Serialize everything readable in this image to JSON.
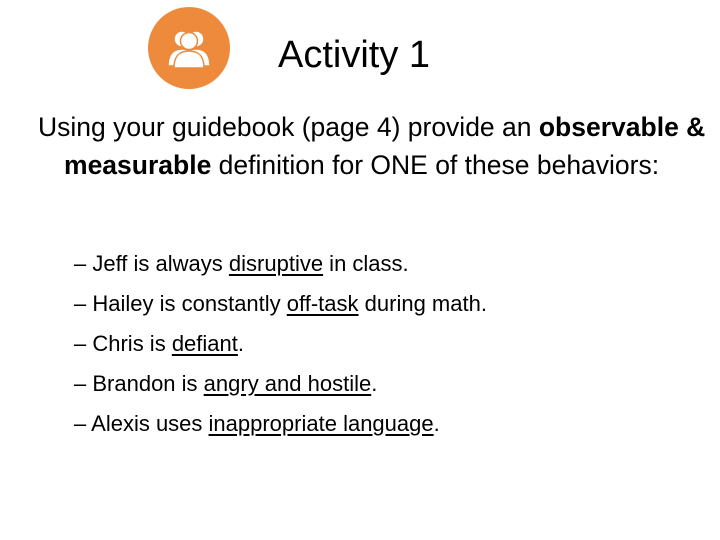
{
  "header": {
    "icon": "group-users-icon",
    "icon_color": "#ee8a3c",
    "title": "Activity 1"
  },
  "intro": {
    "lead": "Using your guidebook (page 4) provide an ",
    "emphasis": "observable & measurable",
    "tail": " definition for ONE of these behaviors:"
  },
  "behaviors": [
    {
      "dash": "– ",
      "before": "Jeff is always ",
      "underlined": "disruptive",
      "after": " in class."
    },
    {
      "dash": "– ",
      "before": "Hailey is constantly ",
      "underlined": "off-task",
      "after": " during math."
    },
    {
      "dash": "– ",
      "before": "Chris is ",
      "underlined": "defiant",
      "after": "."
    },
    {
      "dash": "– ",
      "before": "Brandon is ",
      "underlined": "angry and hostile",
      "after": "."
    },
    {
      "dash": "– ",
      "before": "Alexis uses ",
      "underlined": "inappropriate language",
      "after": "."
    }
  ]
}
